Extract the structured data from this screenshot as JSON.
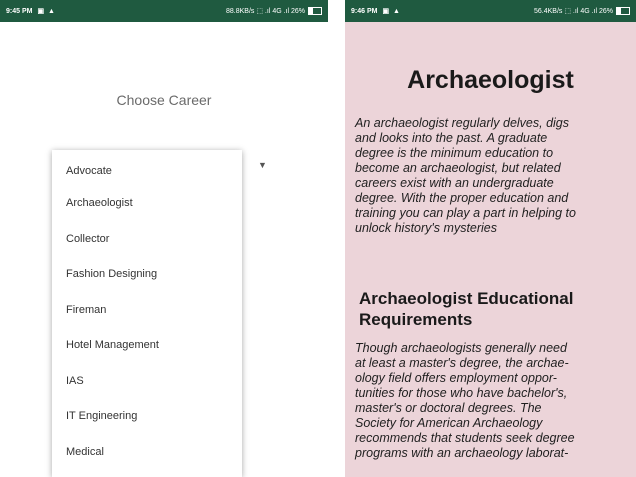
{
  "left_screen": {
    "status_bar": {
      "time": "9:45 PM",
      "icons": "▣ ▲",
      "right": "88.8KB/s ⬚ .ıl 4G .ıl 26%"
    },
    "title": "Choose Career",
    "dropdown_arrow": "▼",
    "menu_items": [
      "Advocate",
      "Archaeologist",
      "Collector",
      "Fashion Designing",
      "Fireman",
      "Hotel Management",
      "IAS",
      "IT Engineering",
      "Medical"
    ]
  },
  "right_screen": {
    "status_bar": {
      "time": "9:46 PM",
      "icons": "▣ ▲",
      "right": "56.4KB/s ⬚ .ıl 4G .ıl 26%"
    },
    "title": "Archaeologist",
    "intro_lines": [
      "  An archaeologist regularly delves, digs",
      "and looks into the past. A graduate",
      "degree is the minimum education to",
      "become an archaeologist, but related",
      "careers exist with an undergraduate",
      "degree. With the proper education and",
      "training you can play a part in helping to",
      "unlock history's mysteries"
    ],
    "section_heading_lines": [
      "Archaeologist Educational",
      "Requirements"
    ],
    "body_lines": [
      "Though archaeologists generally need",
      "at least a master's degree, the archae-",
      "ology field offers employment oppor-",
      "tunities for those who have bachelor's,",
      "master's or doctoral degrees. The",
      "Society for American Archaeology",
      "recommends that students seek degree",
      "programs with an archaeology laborat-"
    ]
  }
}
